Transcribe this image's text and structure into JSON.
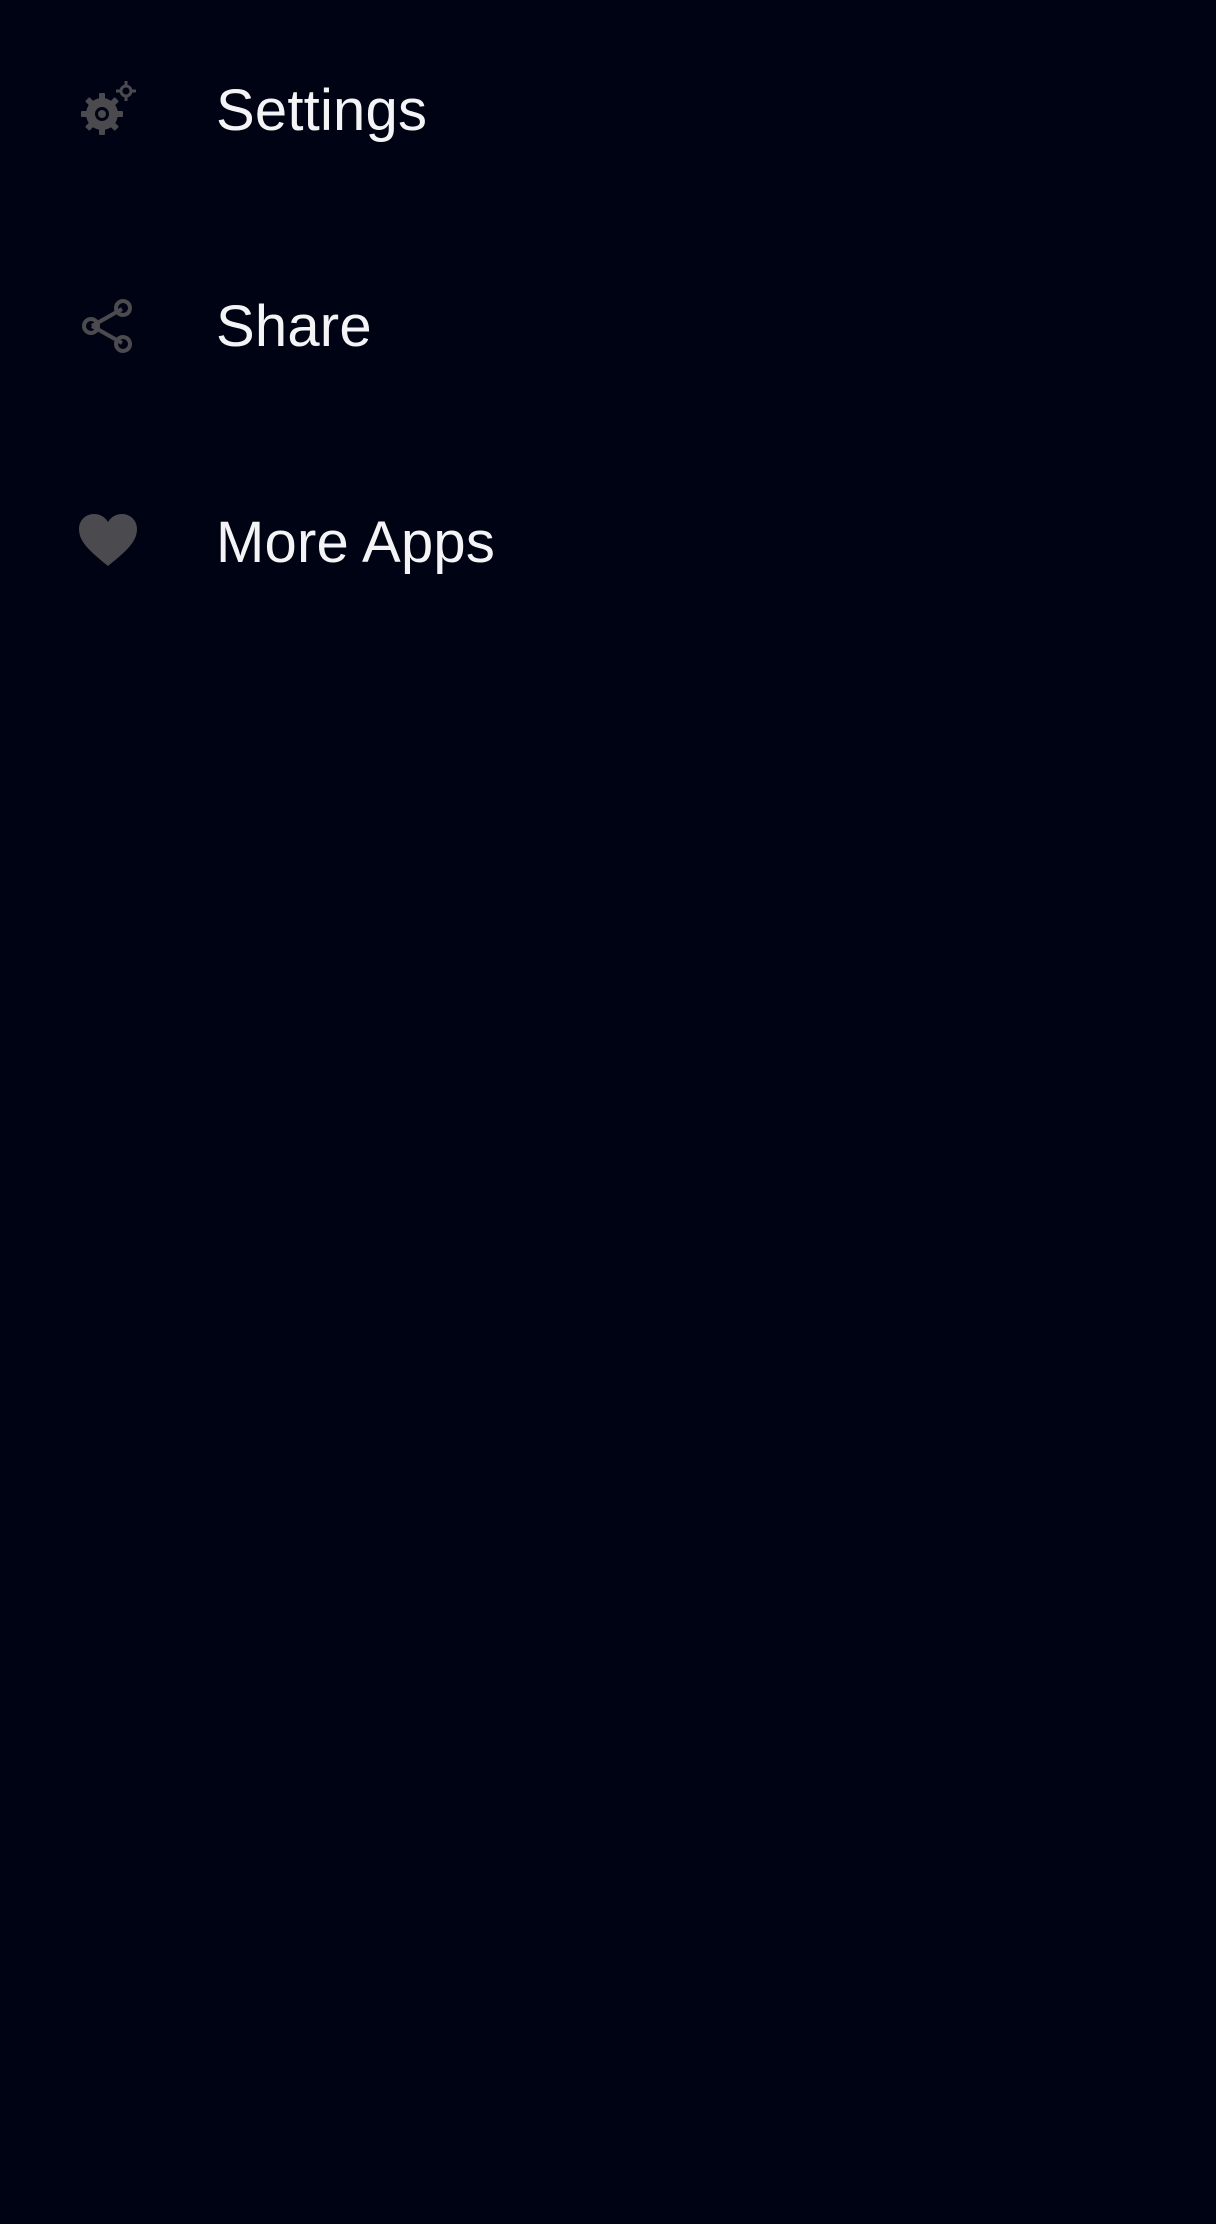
{
  "theme": {
    "background": "#000313",
    "icon_color": "#4a4a4f",
    "text_color": "#f4f4f6"
  },
  "menu": {
    "items": [
      {
        "label": "Settings",
        "icon": "settings-gears-icon"
      },
      {
        "label": "Share",
        "icon": "share-icon"
      },
      {
        "label": "More Apps",
        "icon": "heart-icon"
      }
    ]
  }
}
